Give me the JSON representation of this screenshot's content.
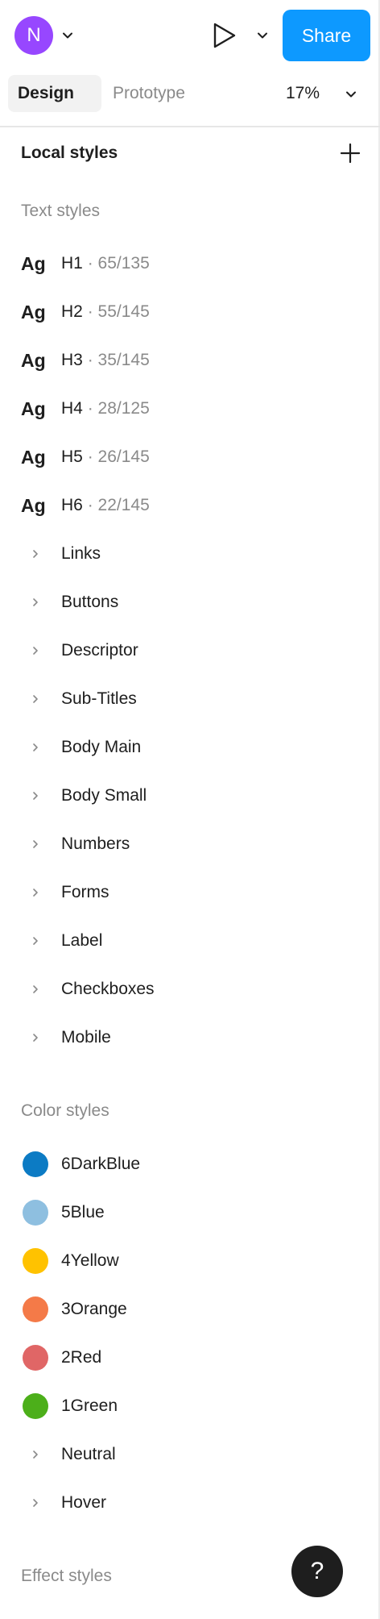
{
  "toolbar": {
    "avatar_initial": "N",
    "share_label": "Share",
    "colors": {
      "avatar": "#9747ff",
      "share": "#0d99ff"
    }
  },
  "tabs": {
    "design": "Design",
    "prototype": "Prototype",
    "zoom": "17%"
  },
  "local_styles": {
    "title": "Local styles",
    "text_styles_label": "Text styles",
    "text_styles": [
      {
        "ag": "Ag",
        "name": "H1",
        "meta": " · 65/135"
      },
      {
        "ag": "Ag",
        "name": "H2",
        "meta": " · 55/145"
      },
      {
        "ag": "Ag",
        "name": "H3",
        "meta": " · 35/145"
      },
      {
        "ag": "Ag",
        "name": "H4",
        "meta": " · 28/125"
      },
      {
        "ag": "Ag",
        "name": "H5",
        "meta": " · 26/145"
      },
      {
        "ag": "Ag",
        "name": "H6",
        "meta": " · 22/145"
      }
    ],
    "text_groups": [
      "Links",
      "Buttons",
      "Descriptor",
      "Sub-Titles",
      "Body Main",
      "Body Small",
      "Numbers",
      "Forms",
      "Label",
      "Checkboxes",
      "Mobile"
    ],
    "color_styles_label": "Color styles",
    "color_styles": [
      {
        "name": "6DarkBlue",
        "color": "#0c7bc4"
      },
      {
        "name": "5Blue",
        "color": "#8ebfe0"
      },
      {
        "name": "4Yellow",
        "color": "#ffc200"
      },
      {
        "name": "3Orange",
        "color": "#f47a48"
      },
      {
        "name": "2Red",
        "color": "#e06666"
      },
      {
        "name": "1Green",
        "color": "#4caf1a"
      }
    ],
    "color_groups": [
      "Neutral",
      "Hover"
    ],
    "effect_styles_label": "Effect styles"
  },
  "help": {
    "label": "?"
  }
}
